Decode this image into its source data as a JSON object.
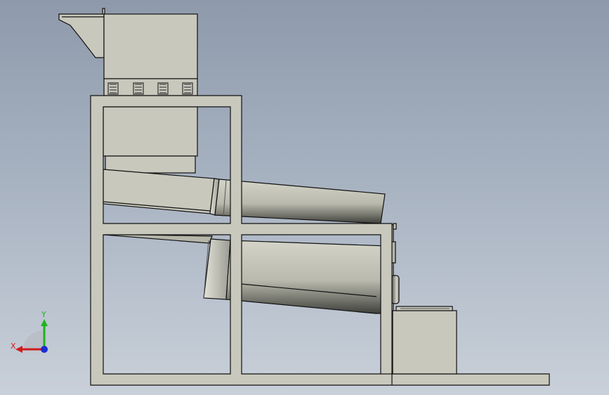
{
  "viewport": {
    "background_top": "#8e9aab",
    "background_bottom": "#c9d0d9"
  },
  "model": {
    "part_fill": "#c8c8bd",
    "edge_color": "#111111",
    "shade_dark": "#3e403b",
    "shade_light": "#d8d8cd"
  },
  "triad": {
    "x_label": "X",
    "y_label": "Y",
    "x_color": "#d21a1a",
    "y_color": "#1fb31f",
    "z_color": "#1a2ed2"
  }
}
